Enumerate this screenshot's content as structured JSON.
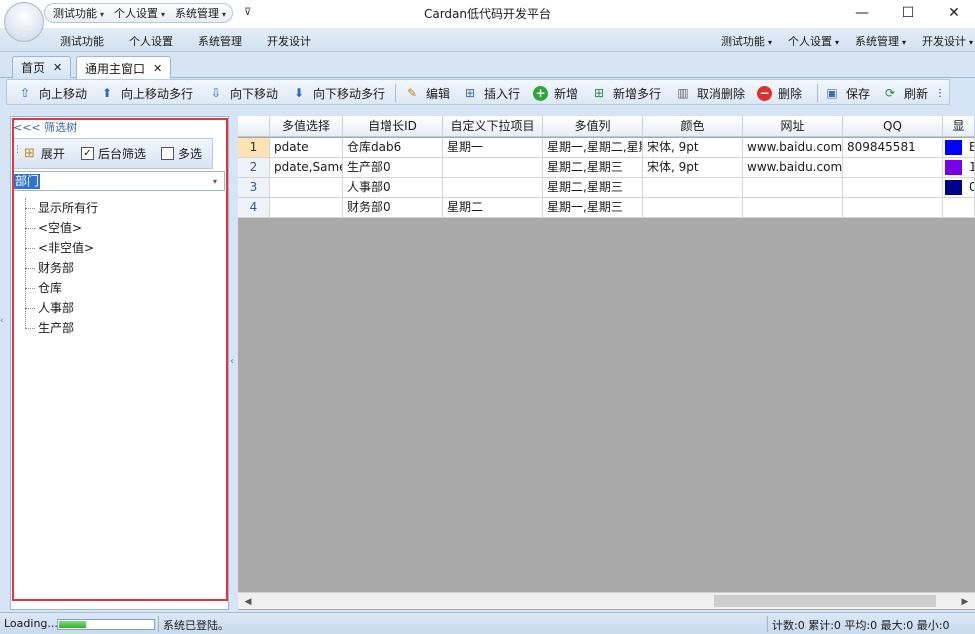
{
  "window": {
    "title": "Cardan低代码开发平台",
    "minimize": "—",
    "maximize": "☐",
    "close": "✕"
  },
  "quick_access": {
    "items": [
      {
        "label": "测试功能"
      },
      {
        "label": "个人设置"
      },
      {
        "label": "系统管理"
      }
    ]
  },
  "menu": {
    "left": [
      "测试功能",
      "个人设置",
      "系统管理",
      "开发设计"
    ],
    "right": [
      "测试功能",
      "个人设置",
      "系统管理",
      "开发设计"
    ]
  },
  "tabs": [
    {
      "label": "首页",
      "active": false
    },
    {
      "label": "通用主窗口",
      "active": true
    }
  ],
  "toolbar": {
    "move_up": "向上移动",
    "move_up_multi": "向上移动多行",
    "move_down": "向下移动",
    "move_down_multi": "向下移动多行",
    "edit": "编辑",
    "insert_row": "插入行",
    "add": "新增",
    "add_multi": "新增多行",
    "cancel_delete": "取消删除",
    "delete": "删除",
    "save": "保存",
    "refresh": "刷新"
  },
  "filter_panel": {
    "header": "<<< 筛选树",
    "expand_label": "展开",
    "backend_filter_label": "后台筛选",
    "backend_filter_checked": true,
    "multi_select_label": "多选",
    "multi_select_checked": false,
    "field_selected": "部门",
    "tree_items": [
      "显示所有行",
      "<空值>",
      "<非空值>",
      "财务部",
      "仓库",
      "人事部",
      "生产部"
    ]
  },
  "grid": {
    "columns": [
      "",
      "多值选择",
      "自增长ID",
      "自定义下拉项目",
      "多值列",
      "颜色",
      "网址",
      "QQ",
      "显"
    ],
    "rows": [
      {
        "rn": "1",
        "c1": "pdate",
        "c2": "仓库dab6",
        "c3": "星期一",
        "c4": "星期一,星期二,星期",
        "c5": "宋体, 9pt",
        "c6": "www.baidu.com",
        "c7": "809845581",
        "swatch": "#0000ff",
        "swtext": "B"
      },
      {
        "rn": "2",
        "c1": "pdate,Same",
        "c2": "生产部0",
        "c3": "",
        "c4": "星期二,星期三",
        "c5": "宋体, 9pt",
        "c6": "www.baidu.com",
        "c7": "",
        "swatch": "#7a00e6",
        "swtext": "1"
      },
      {
        "rn": "3",
        "c1": "",
        "c2": "人事部0",
        "c3": "",
        "c4": "星期二,星期三",
        "c5": "",
        "c6": "",
        "c7": "",
        "swatch": "#00008b",
        "swtext": "0"
      },
      {
        "rn": "4",
        "c1": "",
        "c2": "财务部0",
        "c3": "星期二",
        "c4": "星期一,星期三",
        "c5": "",
        "c6": "",
        "c7": "",
        "swatch": "",
        "swtext": ""
      }
    ]
  },
  "status": {
    "loading": "Loading...",
    "progress": 0.3,
    "message": "系统已登陆。",
    "stats": "计数:0 累计:0 平均:0 最大:0 最小:0"
  },
  "colors": {
    "accent": "#3173d6",
    "highlight_box": "#e8333a",
    "current_row": "#fbe3b3"
  }
}
